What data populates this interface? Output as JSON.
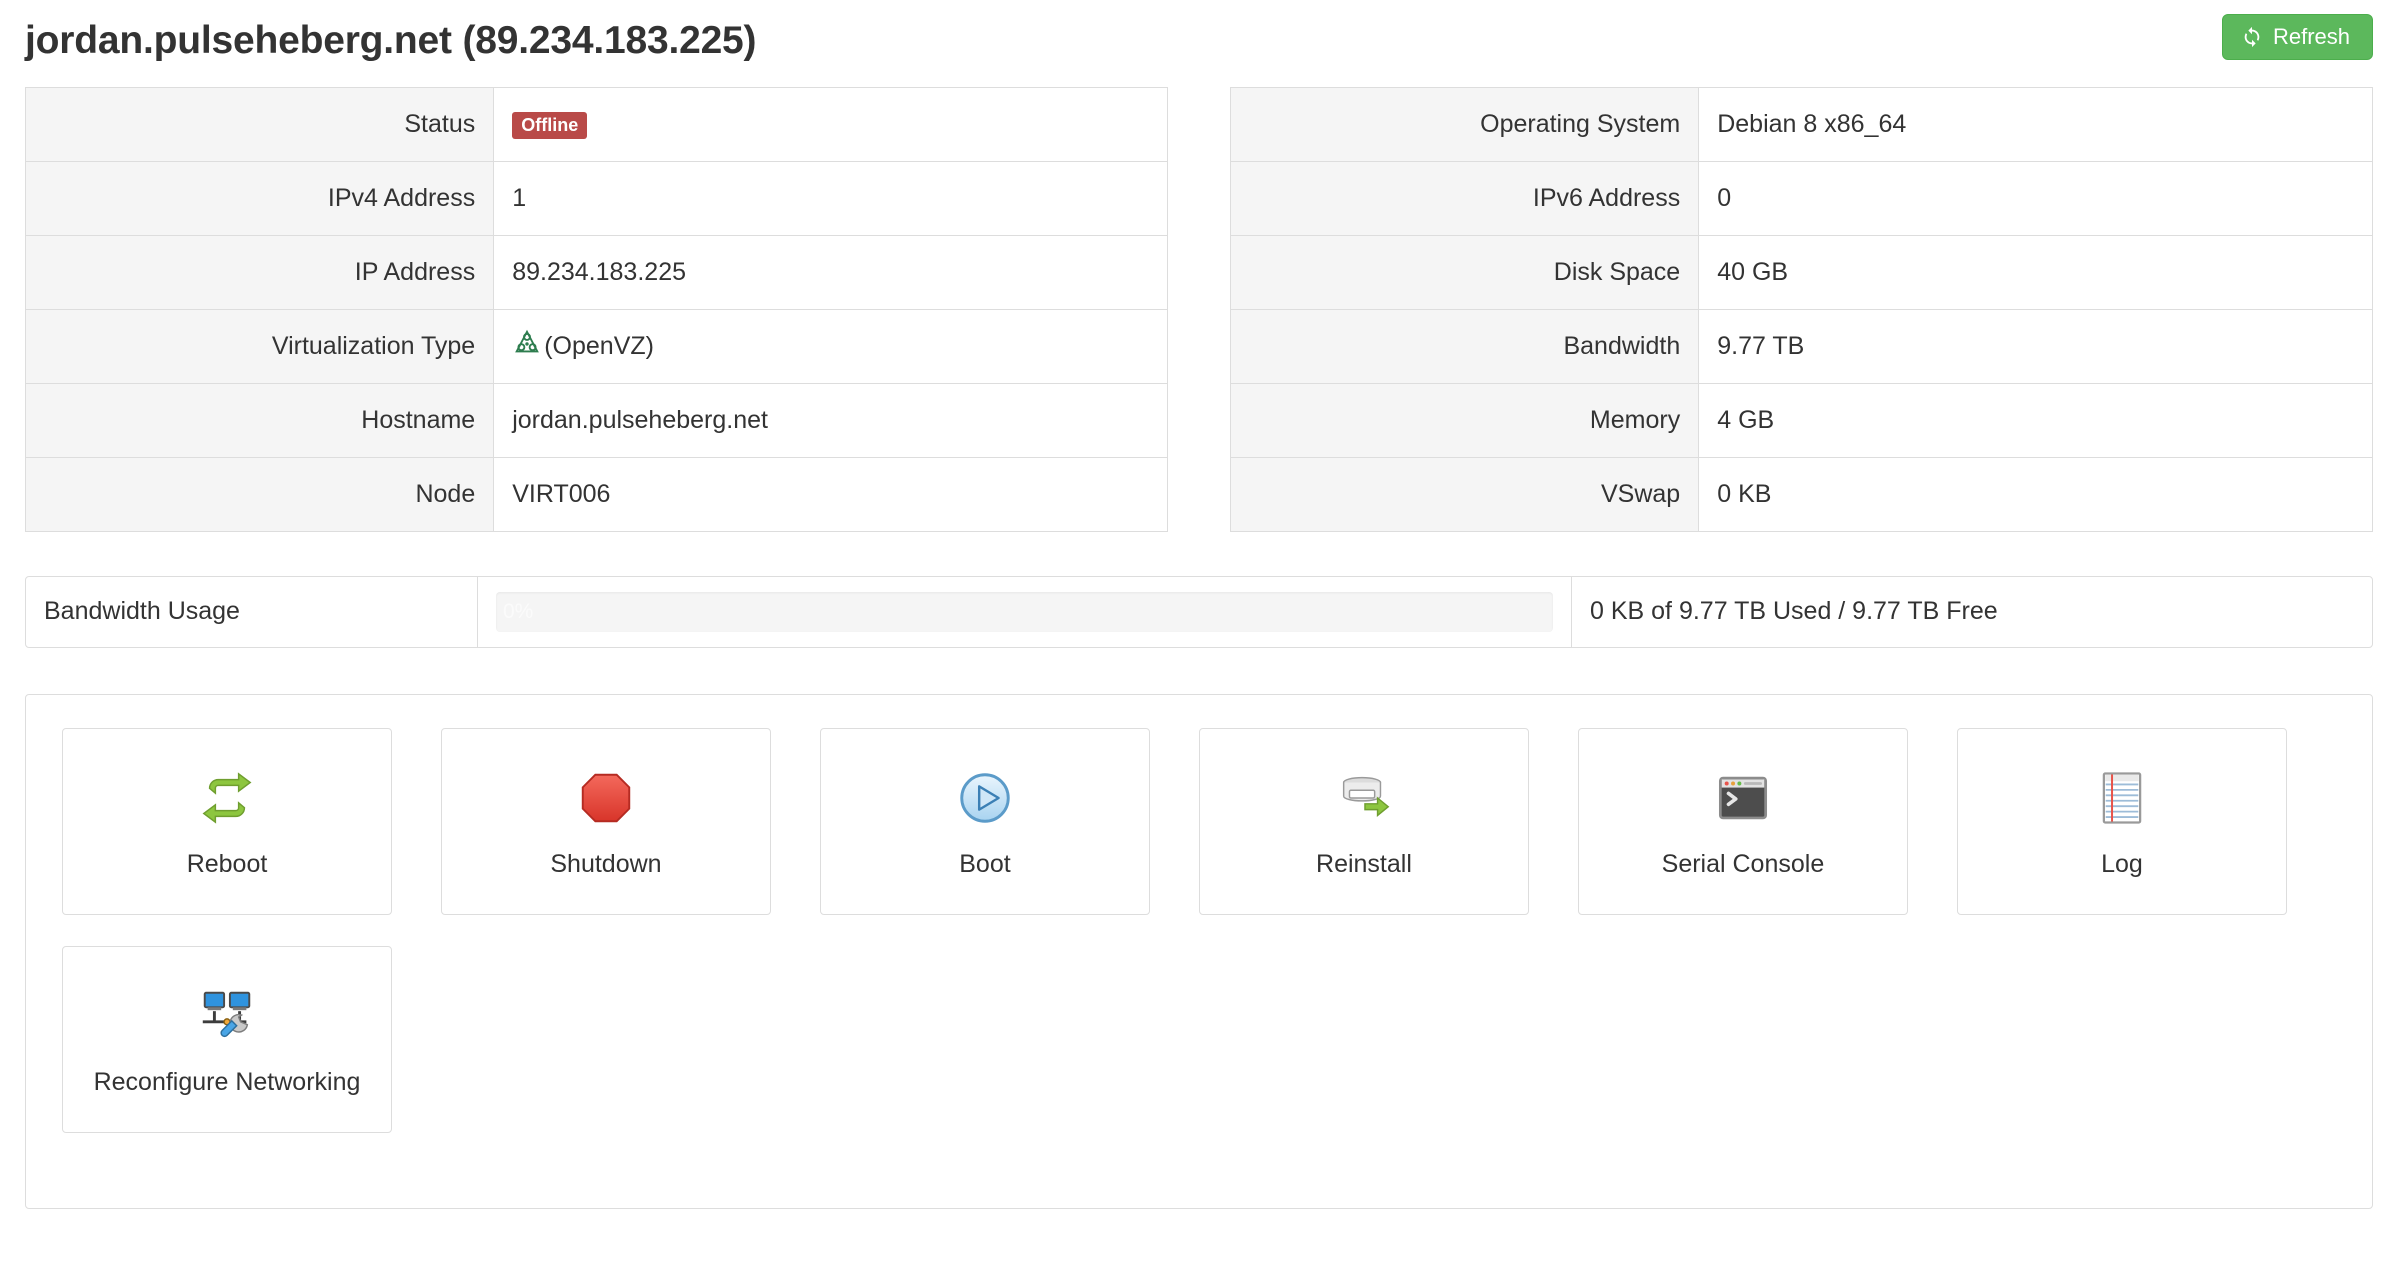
{
  "header": {
    "title": "jordan.pulseheberg.net (89.234.183.225)",
    "refresh_label": "Refresh",
    "refresh_icon": "refresh-icon",
    "refresh_color": "#5cb85c"
  },
  "left_table": {
    "rows": [
      {
        "key": "Status",
        "value": "Offline",
        "type": "badge",
        "badge_color": "#b94a48"
      },
      {
        "key": "IPv4 Address",
        "value": "1",
        "type": "text"
      },
      {
        "key": "IP Address",
        "value": "89.234.183.225",
        "type": "text"
      },
      {
        "key": "Virtualization Type",
        "value": "(OpenVZ)",
        "type": "icon-text",
        "icon": "openvz-icon",
        "icon_color": "#2e7d4f"
      },
      {
        "key": "Hostname",
        "value": "jordan.pulseheberg.net",
        "type": "text"
      },
      {
        "key": "Node",
        "value": "VIRT006",
        "type": "text"
      }
    ]
  },
  "right_table": {
    "rows": [
      {
        "key": "Operating System",
        "value": "Debian 8 x86_64",
        "type": "text"
      },
      {
        "key": "IPv6 Address",
        "value": "0",
        "type": "text"
      },
      {
        "key": "Disk Space",
        "value": "40 GB",
        "type": "text"
      },
      {
        "key": "Bandwidth",
        "value": "9.77 TB",
        "type": "text"
      },
      {
        "key": "Memory",
        "value": "4 GB",
        "type": "text"
      },
      {
        "key": "VSwap",
        "value": "0 KB",
        "type": "text"
      }
    ]
  },
  "bandwidth": {
    "label": "Bandwidth Usage",
    "percent_text": "0%",
    "percent_value": 0,
    "summary": "0 KB of 9.77 TB Used / 9.77 TB Free"
  },
  "actions": [
    {
      "label": "Reboot",
      "icon": "reboot-icon"
    },
    {
      "label": "Shutdown",
      "icon": "shutdown-icon"
    },
    {
      "label": "Boot",
      "icon": "boot-icon"
    },
    {
      "label": "Reinstall",
      "icon": "reinstall-icon"
    },
    {
      "label": "Serial Console",
      "icon": "serial-console-icon"
    },
    {
      "label": "Log",
      "icon": "log-icon"
    },
    {
      "label": "Reconfigure Networking",
      "icon": "reconfigure-networking-icon"
    }
  ]
}
